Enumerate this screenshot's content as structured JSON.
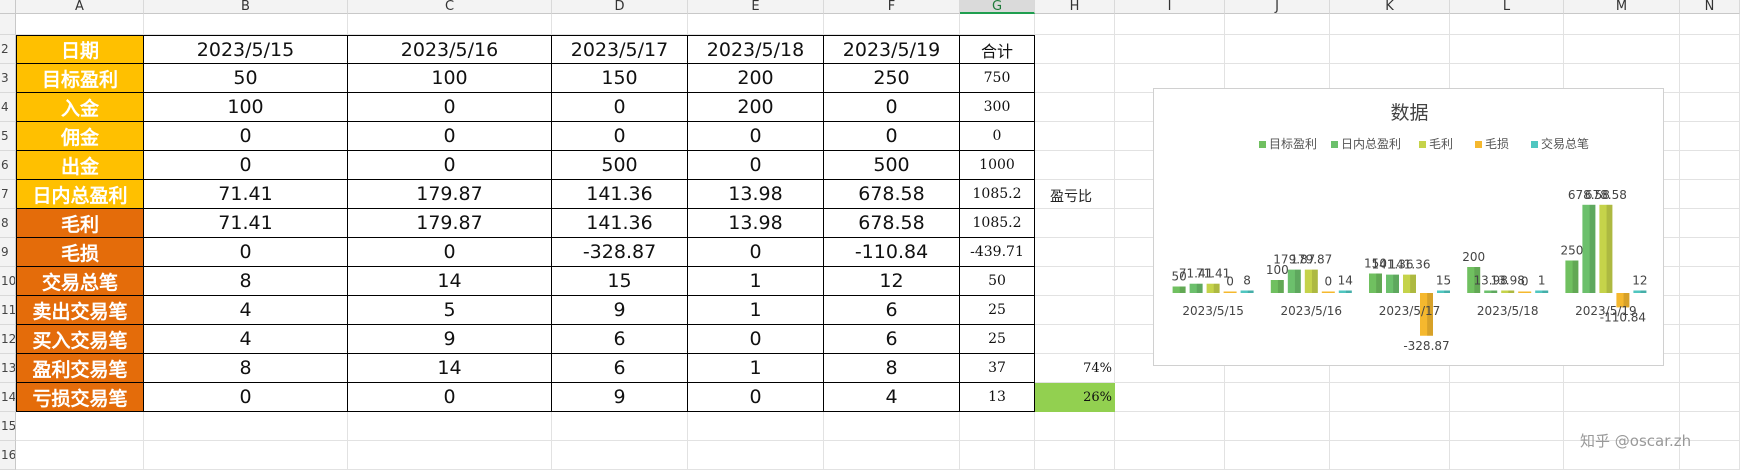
{
  "columns": [
    "A",
    "B",
    "C",
    "D",
    "E",
    "F",
    "G",
    "H",
    "I",
    "J",
    "K",
    "L",
    "M",
    "N"
  ],
  "rows": [
    "2",
    "3",
    "4",
    "5",
    "6",
    "7",
    "8",
    "9",
    "10",
    "11",
    "12",
    "13",
    "14",
    "15",
    "16"
  ],
  "selected_column": "G",
  "table": {
    "header": [
      "日期",
      "2023/5/15",
      "2023/5/16",
      "2023/5/17",
      "2023/5/18",
      "2023/5/19",
      "合计"
    ],
    "rows": [
      {
        "label": "目标盈利",
        "values": [
          "50",
          "100",
          "150",
          "200",
          "250"
        ],
        "total": "750",
        "color": "#ffc000"
      },
      {
        "label": "入金",
        "values": [
          "100",
          "0",
          "0",
          "200",
          "0"
        ],
        "total": "300",
        "color": "#ffc000"
      },
      {
        "label": "佣金",
        "values": [
          "0",
          "0",
          "0",
          "0",
          "0"
        ],
        "total": "0",
        "color": "#ffc000"
      },
      {
        "label": "出金",
        "values": [
          "0",
          "0",
          "500",
          "0",
          "500"
        ],
        "total": "1000",
        "color": "#ffc000"
      },
      {
        "label": "日内总盈利",
        "values": [
          "71.41",
          "179.87",
          "141.36",
          "13.98",
          "678.58"
        ],
        "total": "1085.2",
        "color": "#ffc000"
      },
      {
        "label": "毛利",
        "values": [
          "71.41",
          "179.87",
          "141.36",
          "13.98",
          "678.58"
        ],
        "total": "1085.2",
        "color": "#e46c0a"
      },
      {
        "label": "毛损",
        "values": [
          "0",
          "0",
          "-328.87",
          "0",
          "-110.84"
        ],
        "total": "-439.71",
        "color": "#e46c0a"
      },
      {
        "label": "交易总笔",
        "values": [
          "8",
          "14",
          "15",
          "1",
          "12"
        ],
        "total": "50",
        "color": "#e46c0a"
      },
      {
        "label": "卖出交易笔",
        "values": [
          "4",
          "5",
          "9",
          "1",
          "6"
        ],
        "total": "25",
        "color": "#e46c0a"
      },
      {
        "label": "买入交易笔",
        "values": [
          "4",
          "9",
          "6",
          "0",
          "6"
        ],
        "total": "25",
        "color": "#e46c0a"
      },
      {
        "label": "盈利交易笔",
        "values": [
          "8",
          "14",
          "6",
          "1",
          "8"
        ],
        "total": "37",
        "color": "#e46c0a"
      },
      {
        "label": "亏损交易笔",
        "values": [
          "0",
          "0",
          "9",
          "0",
          "4"
        ],
        "total": "13",
        "color": "#e46c0a"
      }
    ]
  },
  "ratio_label": "盈亏比",
  "win_pct": "74%",
  "loss_pct": "26%",
  "loss_pct_color": "#92d050",
  "chart_data": {
    "type": "bar",
    "title": "数据",
    "categories": [
      "2023/5/15",
      "2023/5/16",
      "2023/5/17",
      "2023/5/18",
      "2023/5/19"
    ],
    "series": [
      {
        "name": "目标盈利",
        "color": "#70c060",
        "values": [
          50,
          100,
          150,
          200,
          250
        ],
        "labels": [
          "50",
          "100",
          "150",
          "200",
          "250"
        ]
      },
      {
        "name": "日内总盈利",
        "color": "#6cc06c",
        "values": [
          71.41,
          179.87,
          141.36,
          13.98,
          678.58
        ],
        "labels": [
          "71.41",
          "179.87",
          "141.36",
          "13.98",
          "678.58"
        ]
      },
      {
        "name": "毛利",
        "color": "#c5d34a",
        "values": [
          71.41,
          179.87,
          141.36,
          13.98,
          678.58
        ],
        "labels": [
          "71.41",
          "179.87",
          "141.36",
          "13.98",
          "678.58"
        ]
      },
      {
        "name": "毛损",
        "color": "#f5b82e",
        "values": [
          0,
          0,
          -328.87,
          0,
          -110.84
        ],
        "labels": [
          "0",
          "0",
          "-328.87",
          "0",
          "-110.84"
        ]
      },
      {
        "name": "交易总笔",
        "color": "#4fc6c0",
        "values": [
          8,
          14,
          15,
          1,
          12
        ],
        "labels": [
          "8",
          "14",
          "15",
          "1",
          "12"
        ]
      }
    ],
    "legend": "top",
    "grid": false
  },
  "watermark": "知乎 @oscar.zh"
}
